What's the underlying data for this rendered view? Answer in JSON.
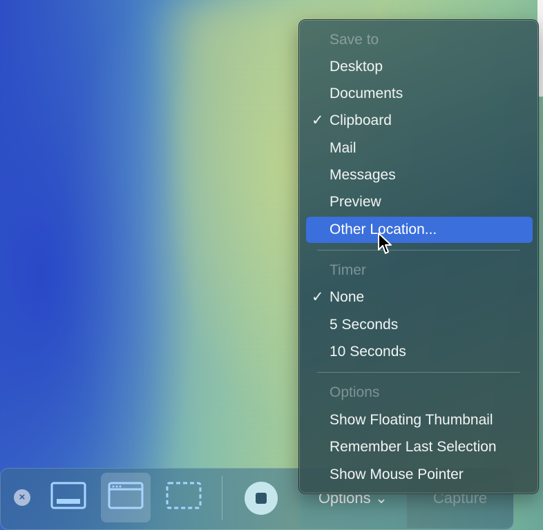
{
  "menu": {
    "save_header": "Save to",
    "save_items": [
      {
        "label": "Desktop",
        "checked": false
      },
      {
        "label": "Documents",
        "checked": false
      },
      {
        "label": "Clipboard",
        "checked": true
      },
      {
        "label": "Mail",
        "checked": false
      },
      {
        "label": "Messages",
        "checked": false
      },
      {
        "label": "Preview",
        "checked": false
      },
      {
        "label": "Other Location...",
        "checked": false,
        "highlighted": true
      }
    ],
    "timer_header": "Timer",
    "timer_items": [
      {
        "label": "None",
        "checked": true
      },
      {
        "label": "5 Seconds",
        "checked": false
      },
      {
        "label": "10 Seconds",
        "checked": false
      }
    ],
    "options_header": "Options",
    "options_items": [
      {
        "label": "Show Floating Thumbnail"
      },
      {
        "label": "Remember Last Selection"
      },
      {
        "label": "Show Mouse Pointer"
      }
    ],
    "check_glyph": "✓"
  },
  "toolbar": {
    "close_glyph": "×",
    "options_label": "Options ⌄",
    "capture_label": "Capture"
  },
  "colors": {
    "highlight": "#3b6fdc",
    "accent_icon": "#a9d4ff"
  }
}
